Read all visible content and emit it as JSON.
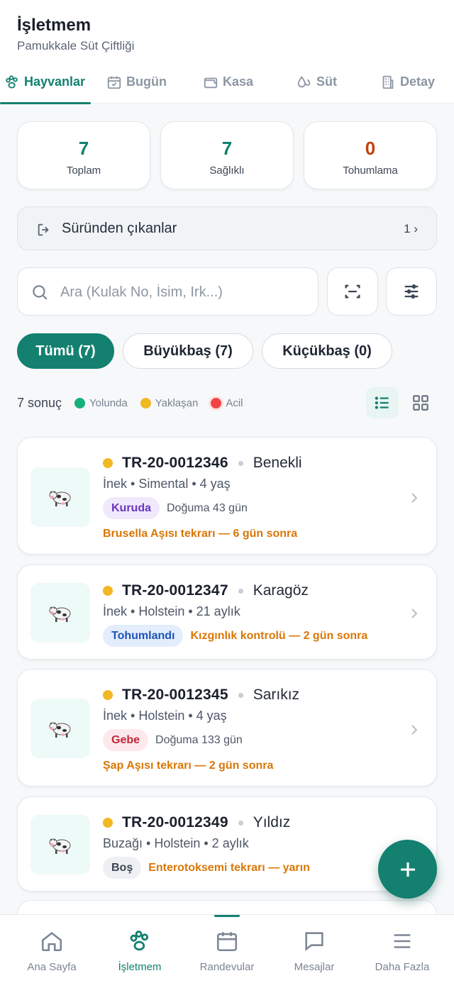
{
  "header": {
    "title": "İşletmem",
    "subtitle": "Pamukkale Süt Çiftliği"
  },
  "tabs": [
    {
      "label": "Hayvanlar",
      "icon": "paw-icon",
      "active": true
    },
    {
      "label": "Bugün",
      "icon": "calendar-check-icon",
      "active": false
    },
    {
      "label": "Kasa",
      "icon": "wallet-icon",
      "active": false
    },
    {
      "label": "Süt",
      "icon": "milk-drops-icon",
      "active": false
    },
    {
      "label": "Detay",
      "icon": "building-icon",
      "active": false
    }
  ],
  "stats": [
    {
      "value": "7",
      "label": "Toplam",
      "color": "#12806e"
    },
    {
      "value": "7",
      "label": "Sağlıklı",
      "color": "#12806e"
    },
    {
      "value": "0",
      "label": "Tohumlama",
      "color": "#c2410c"
    }
  ],
  "exits": {
    "label": "Süründen çıkanlar",
    "count": "1 ›"
  },
  "search": {
    "placeholder": "Ara (Kulak No, İsim, Irk...)",
    "value": ""
  },
  "chips": [
    {
      "label": "Tümü (7)",
      "active": true
    },
    {
      "label": "Büyükbaş (7)",
      "active": false
    },
    {
      "label": "Küçükbaş (0)",
      "active": false
    }
  ],
  "results": {
    "count_text": "7 sonuç",
    "legend": [
      {
        "label": "Yolunda",
        "color": "#16b07a"
      },
      {
        "label": "Yaklaşan",
        "color": "#f2b821"
      },
      {
        "label": "Acil",
        "color": "#ef4444"
      }
    ]
  },
  "animals": [
    {
      "tag": "TR-20-0012346",
      "name": "Benekli",
      "meta": "İnek • Simental • 4 yaş",
      "status": "Kuruda",
      "info": "Doğuma 43 gün",
      "alert": "Brusella Aşısı tekrarı — 6 gün sonra"
    },
    {
      "tag": "TR-20-0012347",
      "name": "Karagöz",
      "meta": "İnek • Holstein • 21 aylık",
      "status": "Tohumlandı",
      "info": "",
      "alert": "Kızgınlık kontrolü — 2 gün sonra"
    },
    {
      "tag": "TR-20-0012345",
      "name": "Sarıkız",
      "meta": "İnek • Holstein • 4 yaş",
      "status": "Gebe",
      "info": "Doğuma 133 gün",
      "alert": "Şap Aşısı tekrarı — 2 gün sonra"
    },
    {
      "tag": "TR-20-0012349",
      "name": "Yıldız",
      "meta": "Buzağı • Holstein • 2 aylık",
      "status": "Boş",
      "info": "",
      "alert": "Enterotoksemi tekrarı — yarın"
    }
  ],
  "bottom_nav": [
    {
      "label": "Ana Sayfa",
      "icon": "home-icon",
      "active": false
    },
    {
      "label": "İşletmem",
      "icon": "paw-icon",
      "active": true
    },
    {
      "label": "Randevular",
      "icon": "calendar-icon",
      "active": false
    },
    {
      "label": "Mesajlar",
      "icon": "chat-icon",
      "active": false
    },
    {
      "label": "Daha Fazla",
      "icon": "menu-icon",
      "active": false
    }
  ],
  "colors": {
    "primary": "#12806e",
    "warning": "#d97706",
    "status_upcoming": "#f2b821"
  }
}
